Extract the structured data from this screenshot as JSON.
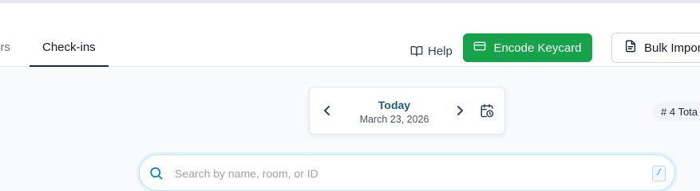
{
  "tabs": {
    "previous_label": "ers",
    "active_label": "Check-ins"
  },
  "toolbar": {
    "help_label": "Help",
    "encode_label": "Encode Keycard",
    "bulk_label": "Bulk Impor"
  },
  "date_nav": {
    "today_label": "Today",
    "date_label": "March 23, 2026"
  },
  "total": {
    "label": "# 4 Tota"
  },
  "search": {
    "placeholder": "Search by name, room, or ID",
    "value": "",
    "shortcut": "/"
  },
  "colors": {
    "accent_green": "#16a34a",
    "today_blue": "#1d5f8a",
    "tab_underline": "#1f2a44",
    "search_border": "#bae6fd"
  },
  "icons": [
    "book-open-icon",
    "keycard-icon",
    "file-import-icon",
    "chevron-left-icon",
    "chevron-right-icon",
    "calendar-clock-icon",
    "search-icon"
  ]
}
